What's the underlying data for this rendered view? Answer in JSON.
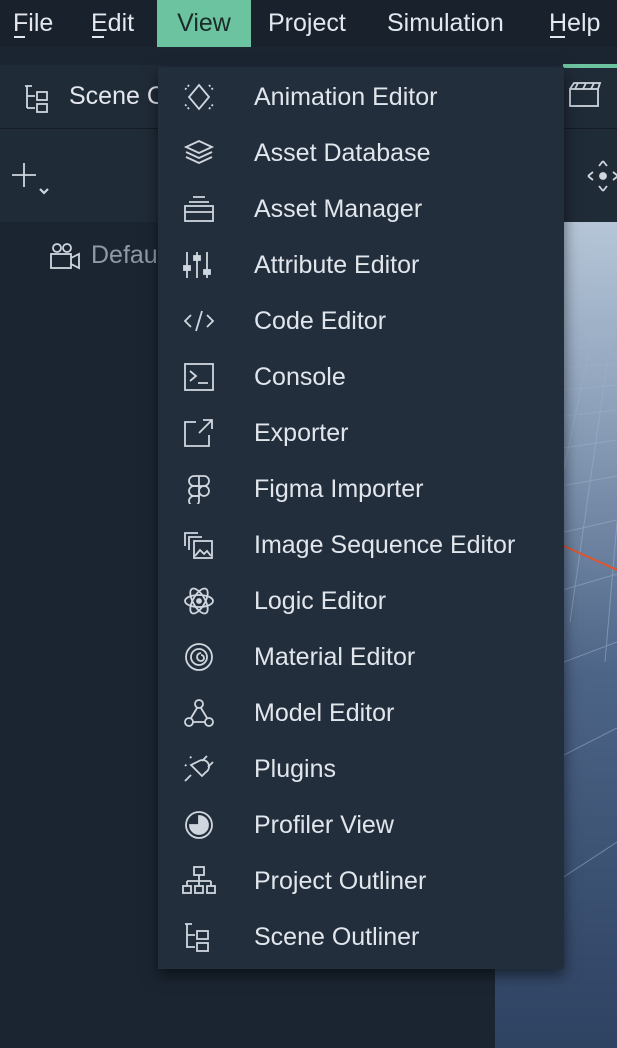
{
  "menubar": {
    "items": [
      {
        "label": "File",
        "mnemonic_first": true
      },
      {
        "label": "Edit",
        "mnemonic_first": true
      },
      {
        "label": "View",
        "active": true
      },
      {
        "label": "Project"
      },
      {
        "label": "Simulation"
      },
      {
        "label": "Help",
        "mnemonic_first": true
      }
    ]
  },
  "panel": {
    "title": "Scene C",
    "tree_item": "Defau"
  },
  "view_menu": {
    "items": [
      {
        "label": "Animation Editor",
        "icon": "animation-icon"
      },
      {
        "label": "Asset Database",
        "icon": "asset-database-icon"
      },
      {
        "label": "Asset Manager",
        "icon": "asset-manager-icon"
      },
      {
        "label": "Attribute Editor",
        "icon": "sliders-icon"
      },
      {
        "label": "Code Editor",
        "icon": "code-icon"
      },
      {
        "label": "Console",
        "icon": "console-icon"
      },
      {
        "label": "Exporter",
        "icon": "export-icon"
      },
      {
        "label": "Figma Importer",
        "icon": "figma-icon"
      },
      {
        "label": "Image Sequence Editor",
        "icon": "image-sequence-icon"
      },
      {
        "label": "Logic Editor",
        "icon": "atom-icon"
      },
      {
        "label": "Material Editor",
        "icon": "material-icon"
      },
      {
        "label": "Model Editor",
        "icon": "model-icon"
      },
      {
        "label": "Plugins",
        "icon": "plug-icon"
      },
      {
        "label": "Profiler View",
        "icon": "profiler-icon"
      },
      {
        "label": "Project Outliner",
        "icon": "hierarchy-icon"
      },
      {
        "label": "Scene Outliner",
        "icon": "scene-tree-icon"
      }
    ]
  },
  "colors": {
    "accent": "#6cc3a0",
    "menu_bg": "#232e3c",
    "menubar_bg": "#18212c"
  }
}
